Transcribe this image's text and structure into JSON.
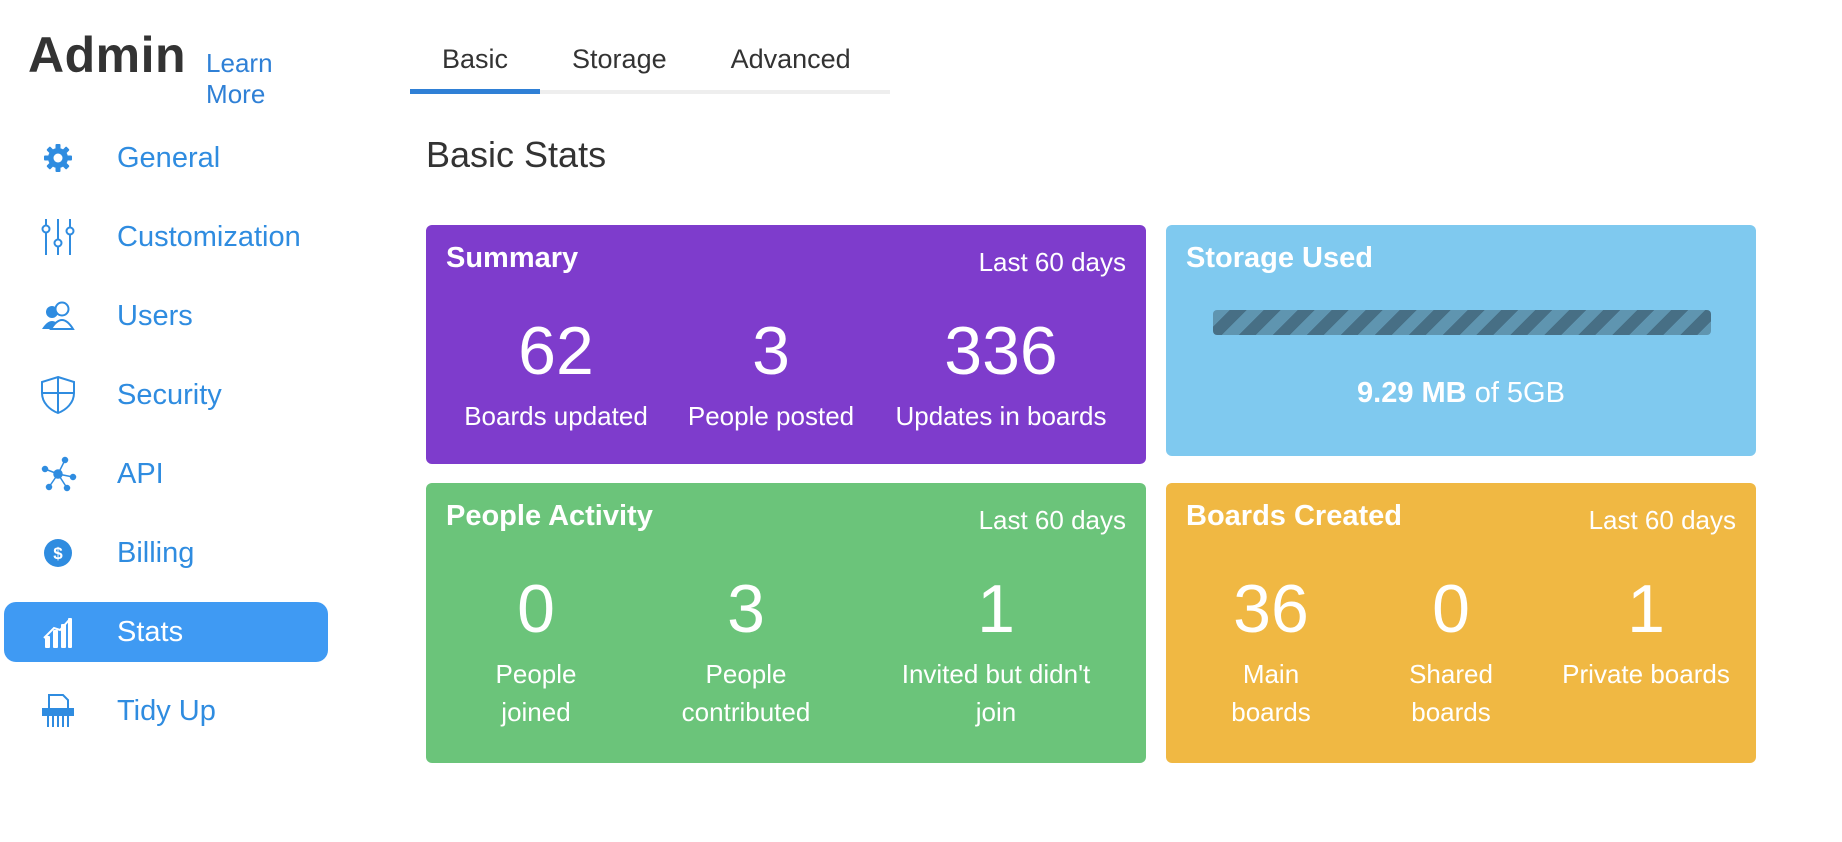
{
  "sidebar": {
    "title": "Admin",
    "learn_more": "Learn More",
    "items": [
      {
        "label": "General",
        "icon": "gear-icon"
      },
      {
        "label": "Customization",
        "icon": "sliders-icon"
      },
      {
        "label": "Users",
        "icon": "users-icon"
      },
      {
        "label": "Security",
        "icon": "shield-icon"
      },
      {
        "label": "API",
        "icon": "api-icon"
      },
      {
        "label": "Billing",
        "icon": "dollar-icon"
      },
      {
        "label": "Stats",
        "icon": "stats-icon",
        "active": true
      },
      {
        "label": "Tidy Up",
        "icon": "shredder-icon"
      }
    ]
  },
  "tabs": [
    {
      "label": "Basic",
      "active": true
    },
    {
      "label": "Storage"
    },
    {
      "label": "Advanced"
    }
  ],
  "section_title": "Basic Stats",
  "summary": {
    "title": "Summary",
    "range": "Last 60 days",
    "stats": [
      {
        "value": "62",
        "label": "Boards updated"
      },
      {
        "value": "3",
        "label": "People posted"
      },
      {
        "value": "336",
        "label": "Updates in boards"
      }
    ]
  },
  "storage": {
    "title": "Storage Used",
    "used": "9.29 MB",
    "of_text": "of 5GB",
    "fill_percent": 100
  },
  "people": {
    "title": "People Activity",
    "range": "Last 60 days",
    "stats": [
      {
        "value": "0",
        "label_lines": [
          "People",
          "joined"
        ]
      },
      {
        "value": "3",
        "label_lines": [
          "People",
          "contributed"
        ]
      },
      {
        "value": "1",
        "label_lines": [
          "Invited but didn't",
          "join"
        ]
      }
    ]
  },
  "boards": {
    "title": "Boards Created",
    "range": "Last 60 days",
    "stats": [
      {
        "value": "36",
        "label_lines": [
          "Main",
          "boards"
        ]
      },
      {
        "value": "0",
        "label_lines": [
          "Shared",
          "boards"
        ]
      },
      {
        "value": "1",
        "label_lines": [
          "Private boards"
        ]
      }
    ]
  },
  "colors": {
    "accent": "#3f9af3",
    "link": "#2f8ce0",
    "summary": "#7e3ccc",
    "storage": "#7fc9ef",
    "people": "#6bc47a",
    "boards": "#f0b843"
  }
}
